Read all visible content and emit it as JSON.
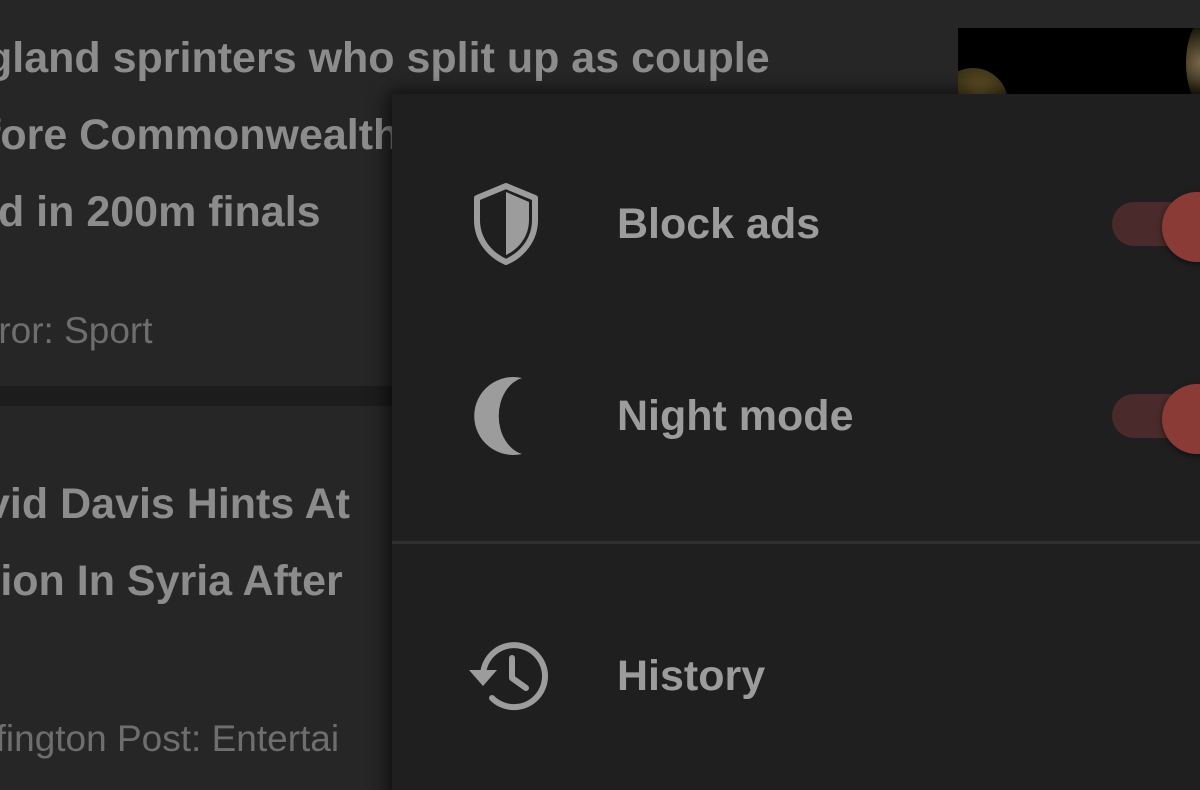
{
  "feed": {
    "cards": [
      {
        "title_lines": [
          "gland sprinters who split up as couple",
          "fore Commonwealth",
          "ld in 200m finals"
        ],
        "source": "rror: Sport"
      },
      {
        "title_lines": [
          "vid Davis Hints At",
          "tion In Syria After"
        ],
        "source": "ffington Post: Entertai"
      }
    ]
  },
  "menu": {
    "items": [
      {
        "label": "Block ads",
        "icon": "shield-icon",
        "toggle": "on"
      },
      {
        "label": "Night mode",
        "icon": "moon-icon",
        "toggle": "on"
      },
      {
        "label": "History",
        "icon": "history-icon"
      }
    ]
  },
  "colors": {
    "background": "#262626",
    "menu_background": "#1f1f1f",
    "text_primary": "#9c9c9c",
    "text_secondary": "#6e6e6e",
    "accent": "#8a3b36",
    "toggle_track": "#4a2a2a"
  }
}
